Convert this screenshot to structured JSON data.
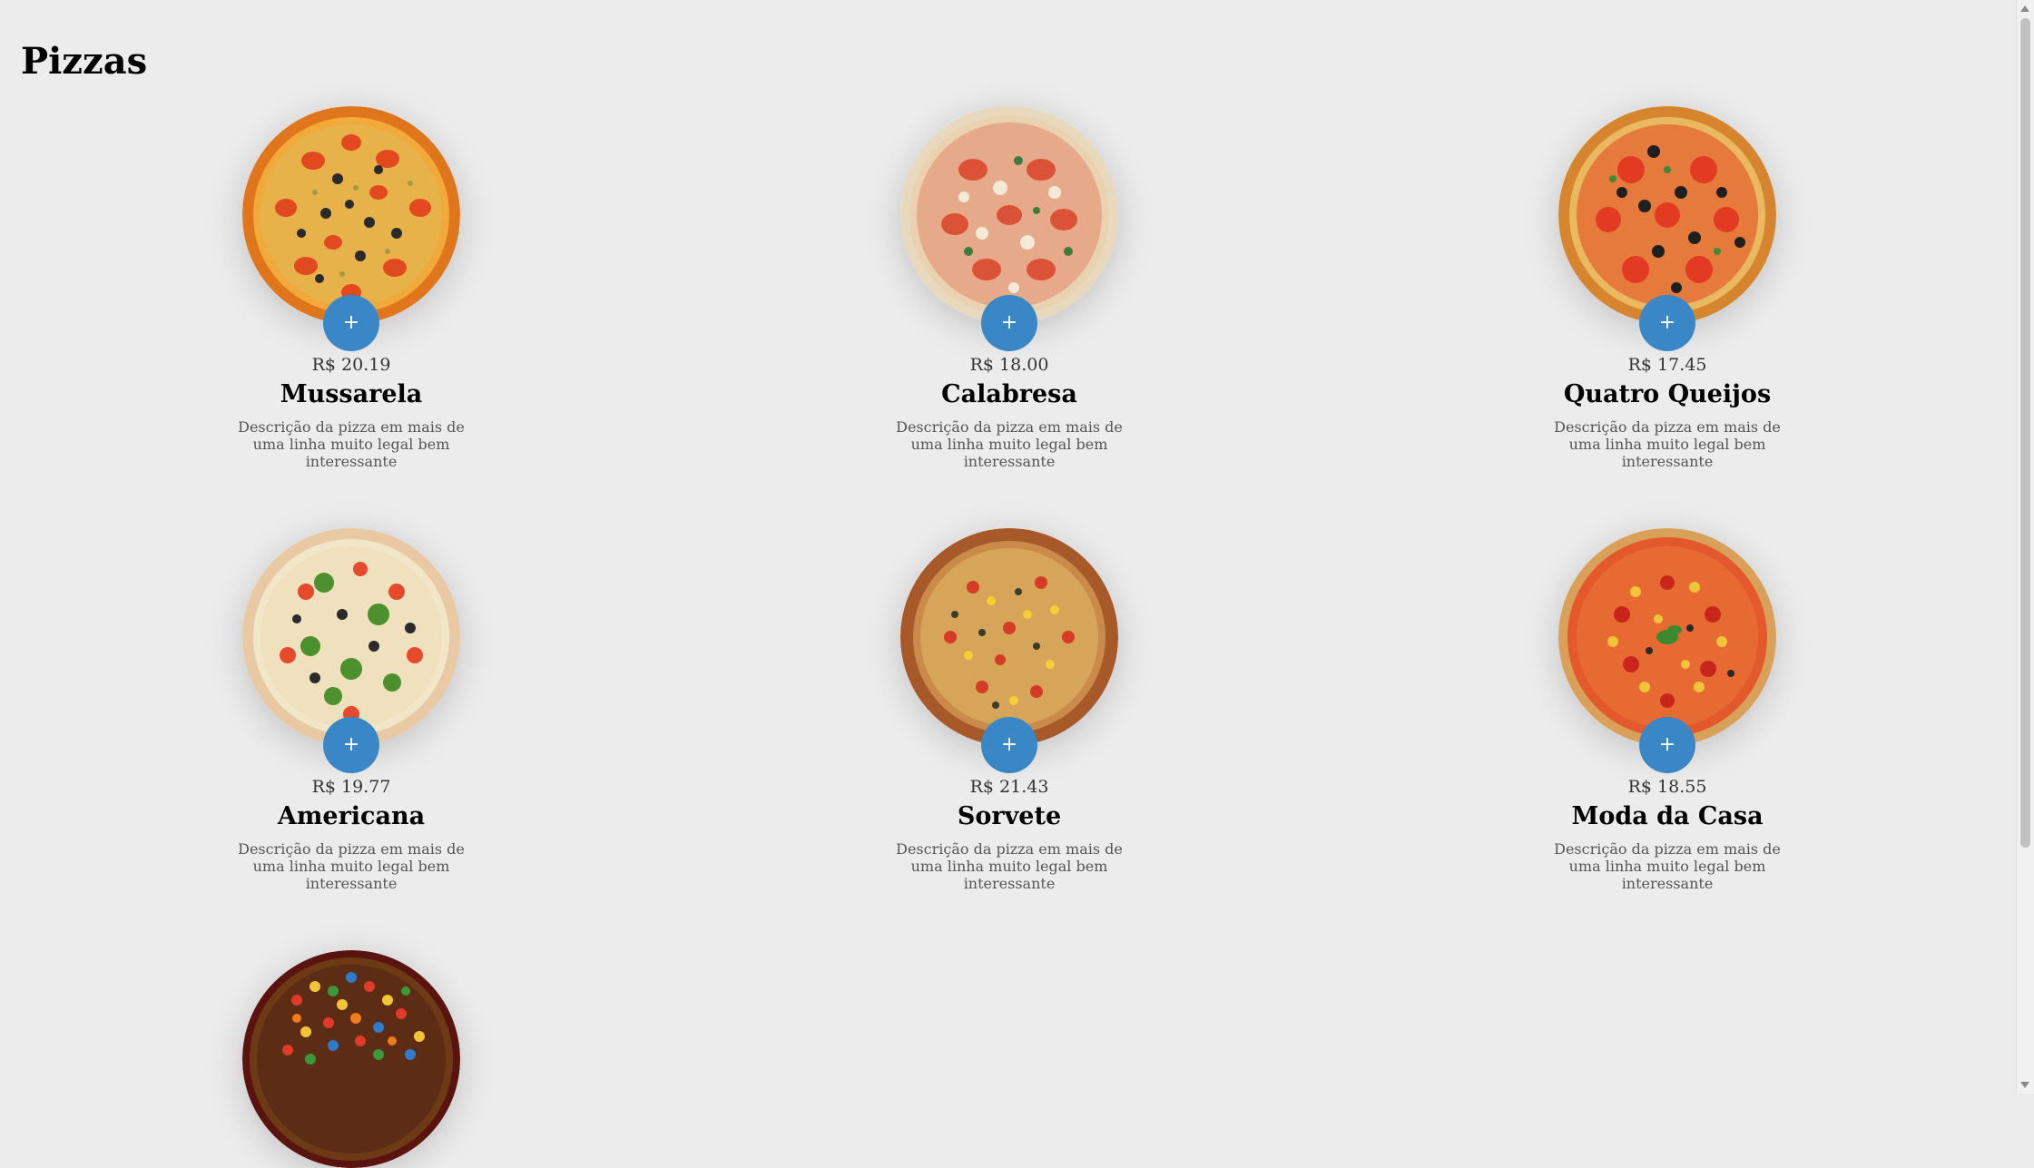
{
  "page": {
    "title": "Pizzas"
  },
  "colors": {
    "accent": "#3a87c7",
    "background": "#ececec"
  },
  "pizzas": [
    {
      "name": "Mussarela",
      "price": "R$ 20.19",
      "description": "Descrição da pizza em mais de uma linha muito legal bem interessante",
      "add_label": "+"
    },
    {
      "name": "Calabresa",
      "price": "R$ 18.00",
      "description": "Descrição da pizza em mais de uma linha muito legal bem interessante",
      "add_label": "+"
    },
    {
      "name": "Quatro Queijos",
      "price": "R$ 17.45",
      "description": "Descrição da pizza em mais de uma linha muito legal bem interessante",
      "add_label": "+"
    },
    {
      "name": "Americana",
      "price": "R$ 19.77",
      "description": "Descrição da pizza em mais de uma linha muito legal bem interessante",
      "add_label": "+"
    },
    {
      "name": "Sorvete",
      "price": "R$ 21.43",
      "description": "Descrição da pizza em mais de uma linha muito legal bem interessante",
      "add_label": "+"
    },
    {
      "name": "Moda da Casa",
      "price": "R$ 18.55",
      "description": "Descrição da pizza em mais de uma linha muito legal bem interessante",
      "add_label": "+"
    }
  ]
}
